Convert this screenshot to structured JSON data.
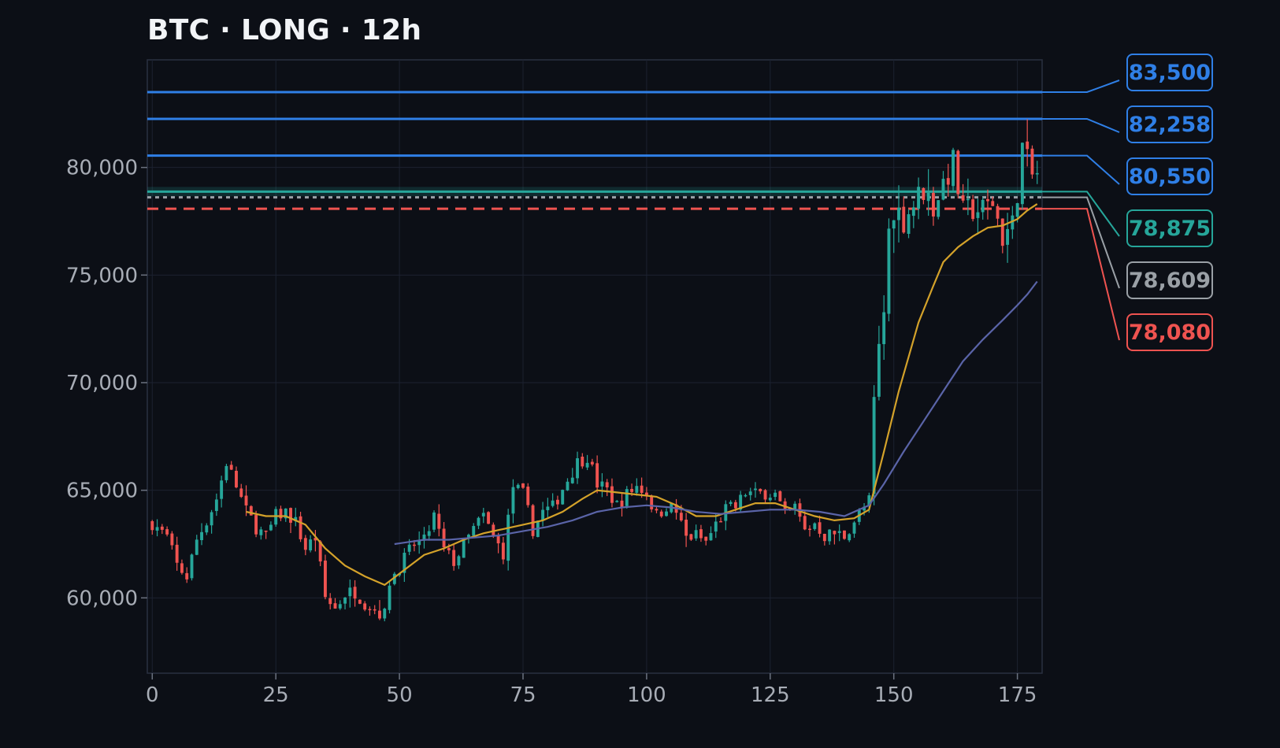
{
  "title": "BTC · LONG · 12h",
  "colors": {
    "background": "#0c0f16",
    "up": "#26a69a",
    "down": "#ef5350",
    "ma_fast": "#d4a22a",
    "ma_slow": "#5a64a8",
    "target": "#2f7fe6",
    "entry": "#26a69a",
    "mid": "#9aa0a6",
    "stop": "#ef5350",
    "grid": "#1c2230",
    "axis_text": "#a8adb6"
  },
  "chart_data": {
    "type": "candlestick",
    "title": "BTC · LONG · 12h",
    "xlim": [
      -1,
      180
    ],
    "ylim": [
      56500,
      85000
    ],
    "xticks": [
      0,
      25,
      50,
      75,
      100,
      125,
      150,
      175
    ],
    "xtick_labels": [
      "0",
      "25",
      "50",
      "75",
      "100",
      "125",
      "150",
      "175"
    ],
    "yticks": [
      60000,
      65000,
      70000,
      75000,
      80000
    ],
    "ytick_labels": [
      "60,000",
      "65,000",
      "70,000",
      "75,000",
      "80,000"
    ],
    "grid": true,
    "close_anchors": [
      [
        0,
        63500
      ],
      [
        3,
        62800
      ],
      [
        5,
        61500
      ],
      [
        7,
        61000
      ],
      [
        9,
        62700
      ],
      [
        11,
        63600
      ],
      [
        13,
        64600
      ],
      [
        15,
        66300
      ],
      [
        17,
        65200
      ],
      [
        19,
        64000
      ],
      [
        21,
        63300
      ],
      [
        23,
        62800
      ],
      [
        25,
        63800
      ],
      [
        27,
        64000
      ],
      [
        29,
        63500
      ],
      [
        31,
        62300
      ],
      [
        33,
        62800
      ],
      [
        35,
        60000
      ],
      [
        37,
        59500
      ],
      [
        39,
        60200
      ],
      [
        41,
        60300
      ],
      [
        43,
        59800
      ],
      [
        45,
        59500
      ],
      [
        47,
        59200
      ],
      [
        48,
        60800
      ],
      [
        51,
        61800
      ],
      [
        53,
        62500
      ],
      [
        55,
        62600
      ],
      [
        57,
        63800
      ],
      [
        59,
        62200
      ],
      [
        61,
        61700
      ],
      [
        63,
        62400
      ],
      [
        65,
        63200
      ],
      [
        67,
        63800
      ],
      [
        69,
        62800
      ],
      [
        71,
        62100
      ],
      [
        73,
        65200
      ],
      [
        75,
        64800
      ],
      [
        77,
        63200
      ],
      [
        79,
        64000
      ],
      [
        81,
        64200
      ],
      [
        83,
        65100
      ],
      [
        86,
        66300
      ],
      [
        88,
        66600
      ],
      [
        90,
        65300
      ],
      [
        92,
        65000
      ],
      [
        94,
        64300
      ],
      [
        96,
        64800
      ],
      [
        98,
        65200
      ],
      [
        100,
        64900
      ],
      [
        102,
        63800
      ],
      [
        104,
        64300
      ],
      [
        106,
        64000
      ],
      [
        108,
        62800
      ],
      [
        110,
        62900
      ],
      [
        112,
        62600
      ],
      [
        114,
        63400
      ],
      [
        116,
        64100
      ],
      [
        118,
        64200
      ],
      [
        120,
        64900
      ],
      [
        122,
        64800
      ],
      [
        124,
        64900
      ],
      [
        126,
        64800
      ],
      [
        128,
        63800
      ],
      [
        130,
        64200
      ],
      [
        132,
        63100
      ],
      [
        134,
        63500
      ],
      [
        136,
        62900
      ],
      [
        138,
        63000
      ],
      [
        140,
        62900
      ],
      [
        142,
        63600
      ],
      [
        144,
        64200
      ],
      [
        145,
        64500
      ],
      [
        146,
        69000
      ],
      [
        147,
        71500
      ],
      [
        148,
        73300
      ],
      [
        149,
        77000
      ],
      [
        150,
        78200
      ],
      [
        152,
        77600
      ],
      [
        154,
        78300
      ],
      [
        156,
        79000
      ],
      [
        158,
        78200
      ],
      [
        160,
        79300
      ],
      [
        162,
        80200
      ],
      [
        164,
        77800
      ],
      [
        166,
        78100
      ],
      [
        168,
        78000
      ],
      [
        170,
        78400
      ],
      [
        172,
        76800
      ],
      [
        174,
        77300
      ],
      [
        175,
        79000
      ],
      [
        176,
        80900
      ],
      [
        177,
        80200
      ],
      [
        178,
        79600
      ],
      [
        179,
        79700
      ]
    ],
    "moving_averages": [
      {
        "color": "#d4a22a",
        "points": [
          [
            19,
            64000
          ],
          [
            23,
            63800
          ],
          [
            27,
            63800
          ],
          [
            31,
            63400
          ],
          [
            35,
            62300
          ],
          [
            39,
            61500
          ],
          [
            43,
            61000
          ],
          [
            47,
            60600
          ],
          [
            51,
            61300
          ],
          [
            55,
            62000
          ],
          [
            59,
            62300
          ],
          [
            63,
            62700
          ],
          [
            67,
            63000
          ],
          [
            71,
            63200
          ],
          [
            75,
            63400
          ],
          [
            79,
            63600
          ],
          [
            83,
            64000
          ],
          [
            87,
            64600
          ],
          [
            90,
            65000
          ],
          [
            94,
            64900
          ],
          [
            98,
            64800
          ],
          [
            102,
            64700
          ],
          [
            106,
            64300
          ],
          [
            110,
            63800
          ],
          [
            114,
            63800
          ],
          [
            118,
            64100
          ],
          [
            122,
            64400
          ],
          [
            126,
            64400
          ],
          [
            130,
            64100
          ],
          [
            134,
            63800
          ],
          [
            138,
            63600
          ],
          [
            142,
            63700
          ],
          [
            145,
            64100
          ],
          [
            148,
            66800
          ],
          [
            151,
            69600
          ],
          [
            155,
            72800
          ],
          [
            158,
            74500
          ],
          [
            160,
            75600
          ],
          [
            163,
            76300
          ],
          [
            166,
            76800
          ],
          [
            169,
            77200
          ],
          [
            172,
            77300
          ],
          [
            175,
            77600
          ],
          [
            177,
            78000
          ],
          [
            179,
            78300
          ]
        ]
      },
      {
        "color": "#5a64a8",
        "points": [
          [
            49,
            62500
          ],
          [
            55,
            62700
          ],
          [
            60,
            62700
          ],
          [
            65,
            62800
          ],
          [
            70,
            62900
          ],
          [
            75,
            63100
          ],
          [
            80,
            63300
          ],
          [
            85,
            63600
          ],
          [
            90,
            64000
          ],
          [
            95,
            64200
          ],
          [
            100,
            64300
          ],
          [
            105,
            64200
          ],
          [
            110,
            64000
          ],
          [
            115,
            63900
          ],
          [
            120,
            64000
          ],
          [
            125,
            64100
          ],
          [
            130,
            64100
          ],
          [
            135,
            64000
          ],
          [
            140,
            63800
          ],
          [
            145,
            64300
          ],
          [
            148,
            65300
          ],
          [
            152,
            66800
          ],
          [
            156,
            68200
          ],
          [
            160,
            69600
          ],
          [
            164,
            71000
          ],
          [
            168,
            72000
          ],
          [
            172,
            72900
          ],
          [
            175,
            73600
          ],
          [
            177,
            74100
          ],
          [
            179,
            74700
          ]
        ]
      }
    ],
    "levels": [
      {
        "value": 83500,
        "label": "83,500",
        "color": "#2f7fe6",
        "style": "solid"
      },
      {
        "value": 82258,
        "label": "82,258",
        "color": "#2f7fe6",
        "style": "solid"
      },
      {
        "value": 80550,
        "label": "80,550",
        "color": "#2f7fe6",
        "style": "solid"
      },
      {
        "value": 78875,
        "label": "78,875",
        "color": "#26a69a",
        "style": "solid"
      },
      {
        "value": 78609,
        "label": "78,609",
        "color": "#9aa0a6",
        "style": "dotted"
      },
      {
        "value": 78080,
        "label": "78,080",
        "color": "#ef5350",
        "style": "dashed"
      }
    ]
  }
}
